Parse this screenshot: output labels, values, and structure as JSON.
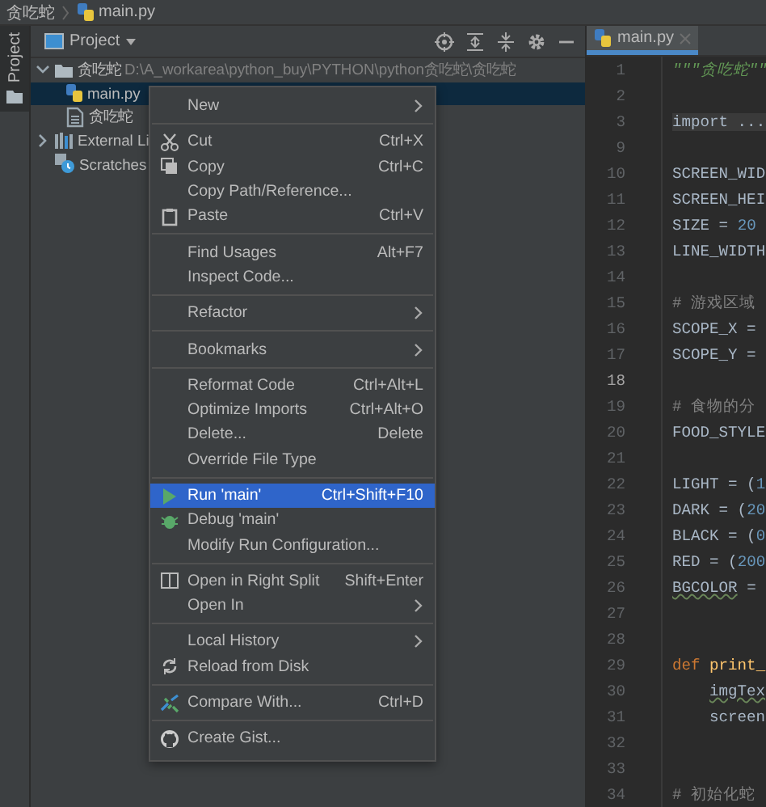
{
  "breadcrumb": [
    {
      "label": "贪吃蛇"
    },
    {
      "label": "main.py",
      "kind": "python-file"
    }
  ],
  "tool_stripe": {
    "label": "Project",
    "selected": true
  },
  "project_panel": {
    "title": "Project",
    "tree": [
      {
        "label": "贪吃蛇",
        "kind": "folder",
        "path": "D:\\A_workarea\\python_buy\\PYTHON\\python贪吃蛇\\贪吃蛇",
        "expanded": true,
        "selected": false,
        "children": [
          {
            "label": "main.py",
            "kind": "python-file",
            "selected": true
          },
          {
            "label": "贪吃蛇",
            "kind": "file",
            "selected": false
          }
        ]
      },
      {
        "label": "External Li",
        "kind": "library",
        "expanded": false,
        "selected": false
      },
      {
        "label": "Scratches",
        "kind": "scratches",
        "selected": false
      }
    ]
  },
  "editor": {
    "tabs": [
      {
        "label": "main.py",
        "selected": true
      }
    ],
    "lines": [
      {
        "number": "1",
        "current": false,
        "tokens": [
          {
            "text": "\"\"\"贪吃蛇\"\"",
            "kind": "string"
          }
        ]
      },
      {
        "number": "2",
        "current": false
      },
      {
        "number": "3",
        "current": false,
        "tokens": [
          {
            "text": "import ...",
            "kind": "folded"
          }
        ]
      },
      {
        "number": "9",
        "current": false
      },
      {
        "number": "10",
        "current": false,
        "tokens": [
          {
            "text": "SCREEN_WID",
            "kind": "plain"
          }
        ]
      },
      {
        "number": "11",
        "current": false,
        "tokens": [
          {
            "text": "SCREEN_HEI",
            "kind": "plain"
          }
        ]
      },
      {
        "number": "12",
        "current": false,
        "tokens": [
          {
            "text": "SIZE = ",
            "kind": "plain"
          },
          {
            "text": "20",
            "kind": "number"
          }
        ]
      },
      {
        "number": "13",
        "current": false,
        "tokens": [
          {
            "text": "LINE_WIDTH",
            "kind": "plain"
          }
        ]
      },
      {
        "number": "14",
        "current": false
      },
      {
        "number": "15",
        "current": false,
        "tokens": [
          {
            "text": "# 游戏区域",
            "kind": "comment"
          }
        ]
      },
      {
        "number": "16",
        "current": false,
        "tokens": [
          {
            "text": "SCOPE_X =",
            "kind": "plain"
          }
        ]
      },
      {
        "number": "17",
        "current": false,
        "tokens": [
          {
            "text": "SCOPE_Y =",
            "kind": "plain"
          }
        ]
      },
      {
        "number": "18",
        "current": true
      },
      {
        "number": "19",
        "current": false,
        "tokens": [
          {
            "text": "# 食物的分",
            "kind": "comment"
          }
        ]
      },
      {
        "number": "20",
        "current": false,
        "tokens": [
          {
            "text": "FOOD_STYLE",
            "kind": "plain"
          }
        ]
      },
      {
        "number": "21",
        "current": false
      },
      {
        "number": "22",
        "current": false,
        "tokens": [
          {
            "text": "LIGHT = (",
            "kind": "plain"
          },
          {
            "text": "1",
            "kind": "number"
          }
        ]
      },
      {
        "number": "23",
        "current": false,
        "tokens": [
          {
            "text": "DARK = (",
            "kind": "plain"
          },
          {
            "text": "20",
            "kind": "number"
          }
        ]
      },
      {
        "number": "24",
        "current": false,
        "tokens": [
          {
            "text": "BLACK = (",
            "kind": "plain"
          },
          {
            "text": "0",
            "kind": "number"
          }
        ]
      },
      {
        "number": "25",
        "current": false,
        "tokens": [
          {
            "text": "RED = (",
            "kind": "plain"
          },
          {
            "text": "200",
            "kind": "number"
          }
        ]
      },
      {
        "number": "26",
        "current": false,
        "tokens": [
          {
            "text": "BGCOLOR",
            "kind": "warning"
          },
          {
            "text": " =",
            "kind": "plain"
          }
        ]
      },
      {
        "number": "27",
        "current": false
      },
      {
        "number": "28",
        "current": false
      },
      {
        "number": "29",
        "current": false,
        "tokens": [
          {
            "text": "def ",
            "kind": "keyword"
          },
          {
            "text": "print_",
            "kind": "function"
          }
        ]
      },
      {
        "number": "30",
        "current": false,
        "indented": true,
        "tokens": [
          {
            "text": "imgTex",
            "kind": "warning"
          }
        ]
      },
      {
        "number": "31",
        "current": false,
        "indented": true,
        "tokens": [
          {
            "text": "screen",
            "kind": "plain"
          }
        ]
      },
      {
        "number": "32",
        "current": false
      },
      {
        "number": "33",
        "current": false
      },
      {
        "number": "34",
        "current": false,
        "tokens": [
          {
            "text": "# 初始化蛇",
            "kind": "comment"
          }
        ]
      }
    ]
  },
  "context_menu": {
    "items": [
      {
        "kind": "item",
        "label": "New",
        "submenu": true,
        "selected": false
      },
      {
        "kind": "separator"
      },
      {
        "kind": "item",
        "label": "Cut",
        "shortcut": "Ctrl+X",
        "selected": false
      },
      {
        "kind": "item",
        "label": "Copy",
        "shortcut": "Ctrl+C",
        "selected": false
      },
      {
        "kind": "item",
        "label": "Copy Path/Reference...",
        "selected": false
      },
      {
        "kind": "item",
        "label": "Paste",
        "shortcut": "Ctrl+V",
        "selected": false
      },
      {
        "kind": "separator"
      },
      {
        "kind": "item",
        "label": "Find Usages",
        "shortcut": "Alt+F7",
        "selected": false
      },
      {
        "kind": "item",
        "label": "Inspect Code...",
        "selected": false
      },
      {
        "kind": "separator"
      },
      {
        "kind": "item",
        "label": "Refactor",
        "submenu": true,
        "selected": false
      },
      {
        "kind": "separator"
      },
      {
        "kind": "item",
        "label": "Bookmarks",
        "submenu": true,
        "selected": false
      },
      {
        "kind": "separator"
      },
      {
        "kind": "item",
        "label": "Reformat Code",
        "shortcut": "Ctrl+Alt+L",
        "selected": false
      },
      {
        "kind": "item",
        "label": "Optimize Imports",
        "shortcut": "Ctrl+Alt+O",
        "selected": false
      },
      {
        "kind": "item",
        "label": "Delete...",
        "shortcut": "Delete",
        "selected": false
      },
      {
        "kind": "item",
        "label": "Override File Type",
        "selected": false
      },
      {
        "kind": "separator"
      },
      {
        "kind": "item",
        "label": "Run 'main'",
        "shortcut": "Ctrl+Shift+F10",
        "selected": true
      },
      {
        "kind": "item",
        "label": "Debug 'main'",
        "selected": false
      },
      {
        "kind": "item",
        "label": "Modify Run Configuration...",
        "selected": false
      },
      {
        "kind": "separator"
      },
      {
        "kind": "item",
        "label": "Open in Right Split",
        "shortcut": "Shift+Enter",
        "selected": false
      },
      {
        "kind": "item",
        "label": "Open In",
        "submenu": true,
        "selected": false
      },
      {
        "kind": "separator"
      },
      {
        "kind": "item",
        "label": "Local History",
        "submenu": true,
        "selected": false
      },
      {
        "kind": "item",
        "label": "Reload from Disk",
        "selected": false
      },
      {
        "kind": "separator"
      },
      {
        "kind": "item",
        "label": "Compare With...",
        "shortcut": "Ctrl+D",
        "selected": false
      },
      {
        "kind": "separator"
      },
      {
        "kind": "item",
        "label": "Create Gist...",
        "selected": false
      }
    ]
  }
}
